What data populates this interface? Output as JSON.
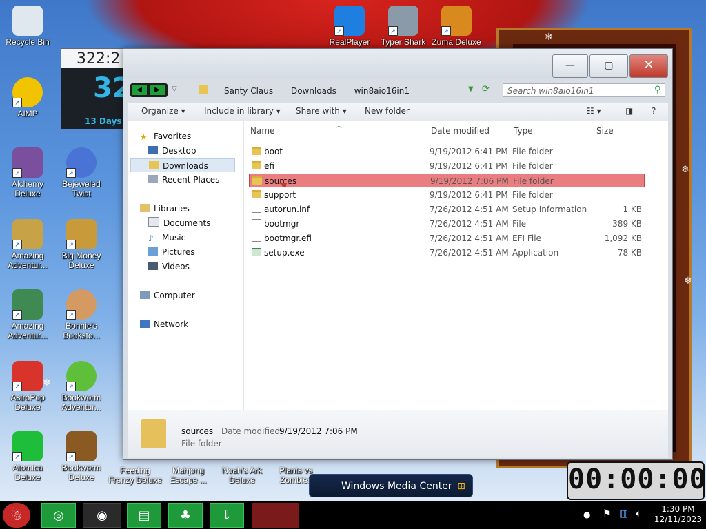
{
  "desktop": {
    "icons_row0": [
      {
        "label": "Recycle Bin"
      },
      {
        "label": "RealPlayer"
      },
      {
        "label": "Typer Shark"
      },
      {
        "label": "Zuma Deluxe"
      }
    ],
    "icons_left": [
      {
        "label": "AIMP"
      },
      {
        "label": "Alchemy Deluxe"
      },
      {
        "label": "Amazing Adventur..."
      },
      {
        "label": "Amazing Adventur..."
      },
      {
        "label": "AstroPop Deluxe"
      },
      {
        "label": "Atomica Deluxe"
      }
    ],
    "icons_second": [
      {
        "label": "Bejeweled Twist"
      },
      {
        "label": "Big Money Deluxe"
      },
      {
        "label": "Bonnie's Booksto..."
      },
      {
        "label": "Bookworm Adventur..."
      },
      {
        "label": "Bookworm Deluxe"
      }
    ],
    "icons_bottom": [
      {
        "label": "Feeding Frenzy Deluxe"
      },
      {
        "label": "Mahjong Escape ..."
      },
      {
        "label": "Noah's Ark Deluxe"
      },
      {
        "label": "Plants vs Zombies"
      }
    ]
  },
  "gadget": {
    "time": "322:2",
    "big": "32",
    "days": "13 Days"
  },
  "window": {
    "minimize": "—",
    "maximize": "▢",
    "close": "✕",
    "breadcrumb": [
      "Santy Claus",
      "Downloads",
      "win8aio16in1"
    ],
    "search_placeholder": "Search win8aio16in1",
    "toolbar": {
      "organize": "Organize",
      "include": "Include in library",
      "share": "Share with",
      "new_folder": "New folder"
    },
    "nav": {
      "favorites": "Favorites",
      "desktop": "Desktop",
      "downloads": "Downloads",
      "recent": "Recent Places",
      "libraries": "Libraries",
      "documents": "Documents",
      "music": "Music",
      "pictures": "Pictures",
      "videos": "Videos",
      "computer": "Computer",
      "network": "Network"
    },
    "columns": {
      "name": "Name",
      "date": "Date modified",
      "type": "Type",
      "size": "Size"
    },
    "files": [
      {
        "name": "boot",
        "date": "9/19/2012 6:41 PM",
        "type": "File folder",
        "size": ""
      },
      {
        "name": "efi",
        "date": "9/19/2012 6:41 PM",
        "type": "File folder",
        "size": ""
      },
      {
        "name": "sources",
        "date": "9/19/2012 7:06 PM",
        "type": "File folder",
        "size": ""
      },
      {
        "name": "support",
        "date": "9/19/2012 6:41 PM",
        "type": "File folder",
        "size": ""
      },
      {
        "name": "autorun.inf",
        "date": "7/26/2012 4:51 AM",
        "type": "Setup Information",
        "size": "1 KB"
      },
      {
        "name": "bootmgr",
        "date": "7/26/2012 4:51 AM",
        "type": "File",
        "size": "389 KB"
      },
      {
        "name": "bootmgr.efi",
        "date": "7/26/2012 4:51 AM",
        "type": "EFI File",
        "size": "1,092 KB"
      },
      {
        "name": "setup.exe",
        "date": "7/26/2012 4:51 AM",
        "type": "Application",
        "size": "78 KB"
      }
    ],
    "details": {
      "name": "sources",
      "date_label": "Date modified:",
      "date_value": "9/19/2012 7:06 PM",
      "type": "File folder"
    }
  },
  "media_center": {
    "label": "Windows Media Center"
  },
  "timer": {
    "value": "00:00:00"
  },
  "taskbar": {
    "time": "1:30 PM",
    "date": "12/11/2023"
  },
  "colors": {
    "selection": "#e97d80",
    "taskbar_app": "#1e9a3b"
  }
}
